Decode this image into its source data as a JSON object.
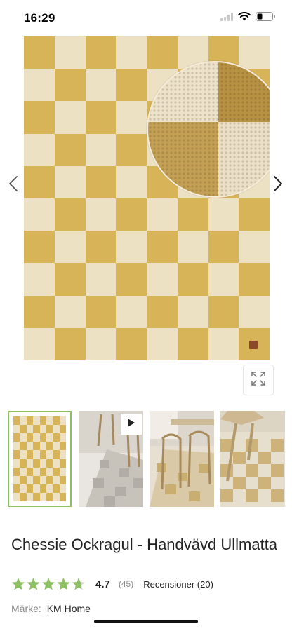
{
  "status_bar": {
    "time": "16:29"
  },
  "gallery": {
    "main_image": "checkered-rug-ochre-cream",
    "colors": {
      "ochre": "#d8b459",
      "cream": "#ede1c4",
      "label": "#8a4a2a"
    },
    "prev_icon": "chevron-left-icon",
    "next_icon": "chevron-right-icon",
    "expand_icon": "expand-icon"
  },
  "thumbnails": [
    {
      "name": "rug-overview",
      "selected": true
    },
    {
      "name": "dining-room-video",
      "has_video": true
    },
    {
      "name": "dining-room-chairs"
    },
    {
      "name": "rug-closeup-chair"
    }
  ],
  "product": {
    "title": "Chessie Ockragul - Handvävd Ullmatta",
    "rating_value": "4.7",
    "rating_stars": 4.7,
    "rating_count": "(45)",
    "reviews_label": "Recensioner (20)",
    "brand_label": "Märke:",
    "brand_value": "KM Home",
    "accent_color": "#8cc063"
  }
}
